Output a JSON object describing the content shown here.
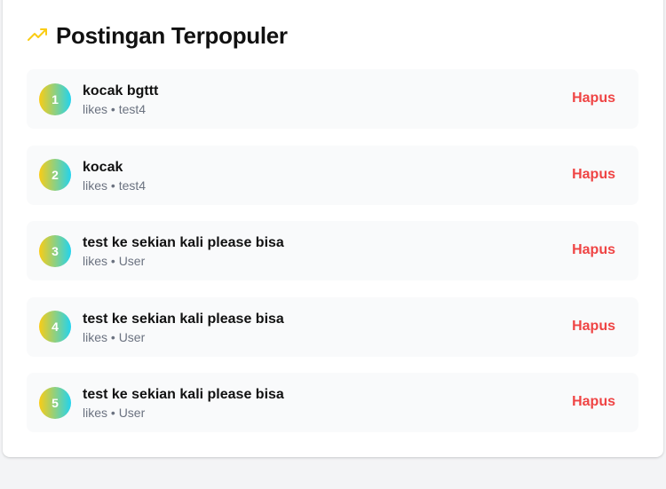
{
  "header": {
    "title": "Postingan Terpopuler",
    "icon": "trending-up-icon",
    "icon_color": "#facc15"
  },
  "colors": {
    "rank_gradient_start": "#facc15",
    "rank_gradient_end": "#22d3ee",
    "delete": "#ef4444"
  },
  "posts": [
    {
      "rank": "1",
      "title": "kocak bgttt",
      "meta": "likes • test4",
      "delete_label": "Hapus"
    },
    {
      "rank": "2",
      "title": "kocak",
      "meta": "likes • test4",
      "delete_label": "Hapus"
    },
    {
      "rank": "3",
      "title": "test ke sekian kali please bisa",
      "meta": "likes • User",
      "delete_label": "Hapus"
    },
    {
      "rank": "4",
      "title": "test ke sekian kali please bisa",
      "meta": "likes • User",
      "delete_label": "Hapus"
    },
    {
      "rank": "5",
      "title": "test ke sekian kali please bisa",
      "meta": "likes • User",
      "delete_label": "Hapus"
    }
  ]
}
